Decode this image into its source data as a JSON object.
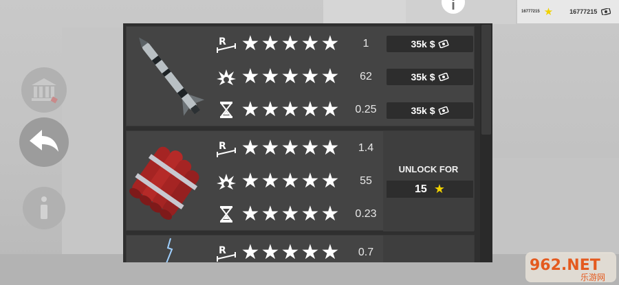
{
  "hud": {
    "stars_amount": "16777215",
    "cash_amount": "16777215"
  },
  "weapons": [
    {
      "name": "missile",
      "stats": [
        {
          "icon": "range-icon",
          "value": "1",
          "price": "35k $"
        },
        {
          "icon": "explosion-icon",
          "value": "62",
          "price": "35k $"
        },
        {
          "icon": "hourglass-icon",
          "value": "0.25",
          "price": "35k $"
        }
      ]
    },
    {
      "name": "dynamite",
      "stats": [
        {
          "icon": "range-icon",
          "value": "1.4"
        },
        {
          "icon": "explosion-icon",
          "value": "55"
        },
        {
          "icon": "hourglass-icon",
          "value": "0.23"
        }
      ],
      "unlock_label": "UNLOCK FOR",
      "unlock_cost": "15"
    },
    {
      "name": "lightning",
      "stats": [
        {
          "icon": "range-icon",
          "value": "0.7"
        }
      ]
    }
  ],
  "watermark": {
    "text": "962.NET",
    "subtext": "乐游网"
  },
  "colors": {
    "star_gold": "#f1d200",
    "panel": "#2f2f2f",
    "card": "#444444"
  }
}
